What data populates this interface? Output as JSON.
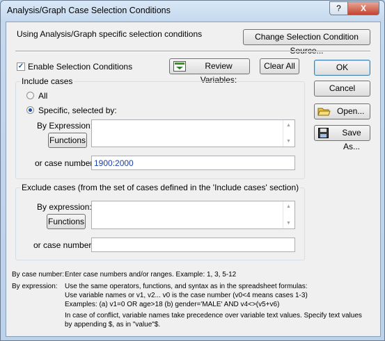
{
  "window": {
    "title": "Analysis/Graph Case Selection Conditions",
    "help_glyph": "?",
    "close_glyph": "X"
  },
  "top": {
    "source_text": "Using Analysis/Graph specific selection conditions",
    "change_source_button": "Change Selection Condition Source..."
  },
  "enable": {
    "label": "Enable Selection Conditions",
    "checked": true
  },
  "toolbar": {
    "review_variables": "Review Variables:",
    "clear_all": "Clear All"
  },
  "side_buttons": {
    "ok": "OK",
    "cancel": "Cancel",
    "open": "Open...",
    "save_as": "Save As..."
  },
  "include": {
    "title": "Include cases",
    "radio_all": "All",
    "radio_specific": "Specific, selected by:",
    "selected": "specific",
    "expression_label": "By Expression:",
    "expression_value": "",
    "functions_button": "Functions",
    "case_number_label": "or case number:",
    "case_number_value": "1900:2000"
  },
  "exclude": {
    "title": "Exclude cases (from the set of cases defined in the 'Include cases' section)",
    "expression_label": "By expression:",
    "expression_value": "",
    "functions_button": "Functions",
    "case_number_label": "or case number:",
    "case_number_value": ""
  },
  "help": {
    "by_case_label": "By case number:",
    "by_case_text": "Enter case numbers and/or ranges.  Example:  1, 3, 5-12",
    "by_expr_label": "By expression:",
    "by_expr_line1": "Use the same operators, functions, and syntax as in the spreadsheet formulas:",
    "by_expr_line2": "Use variable names or v1, v2...   v0 is the case number  (v0<4 means cases 1-3)",
    "by_expr_line3": "Examples:  (a) v1=0 OR age>18  (b) gender='MALE' AND v4<>(v5+v6)",
    "by_expr_line4": "In case of conflict, variable names take precedence over variable text values. Specify text values",
    "by_expr_line5": "by appending $, as in \"value\"$."
  },
  "colors": {
    "case_number_text": "#1a3ea8",
    "client_bg": "#f0f0f0"
  }
}
